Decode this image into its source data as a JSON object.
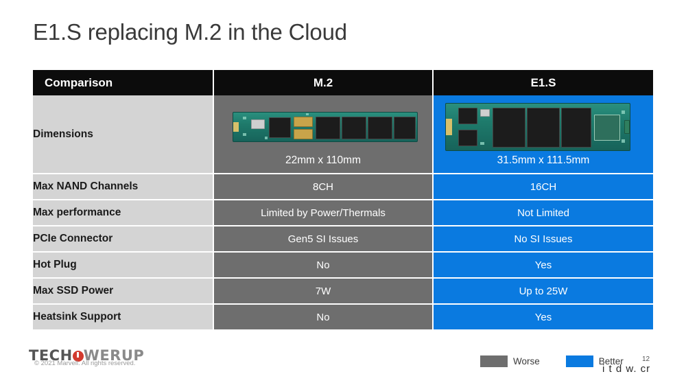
{
  "slide": {
    "title": "E1.S replacing M.2 in the Cloud",
    "page_number": "12",
    "copyright": "© 2021 Marvell. All rights reserved.",
    "watermark": "i t d w. cr",
    "logo": {
      "part1": "TECH",
      "part2": "WER",
      "part3": "UP",
      "dot": "power-button-icon"
    }
  },
  "table": {
    "headers": {
      "comparison": "Comparison",
      "m2": "M.2",
      "e1s": "E1.S"
    },
    "rows": [
      {
        "label": "Dimensions",
        "m2": "22mm x 110mm",
        "e1s": "31.5mm x 111.5mm",
        "type": "image-row"
      },
      {
        "label": "Max NAND Channels",
        "m2": "8CH",
        "e1s": "16CH"
      },
      {
        "label": "Max performance",
        "m2": "Limited by Power/Thermals",
        "e1s": "Not Limited"
      },
      {
        "label": "PCIe Connector",
        "m2": "Gen5 SI Issues",
        "e1s": "No SI Issues"
      },
      {
        "label": "Hot Plug",
        "m2": "No",
        "e1s": "Yes"
      },
      {
        "label": "Max SSD Power",
        "m2": "7W",
        "e1s": "Up to 25W"
      },
      {
        "label": "Heatsink Support",
        "m2": "No",
        "e1s": "Yes"
      }
    ]
  },
  "legend": {
    "worse_label": "Worse",
    "better_label": "Better",
    "worse_color": "#6e6e6e",
    "better_color": "#0a7ae0"
  }
}
